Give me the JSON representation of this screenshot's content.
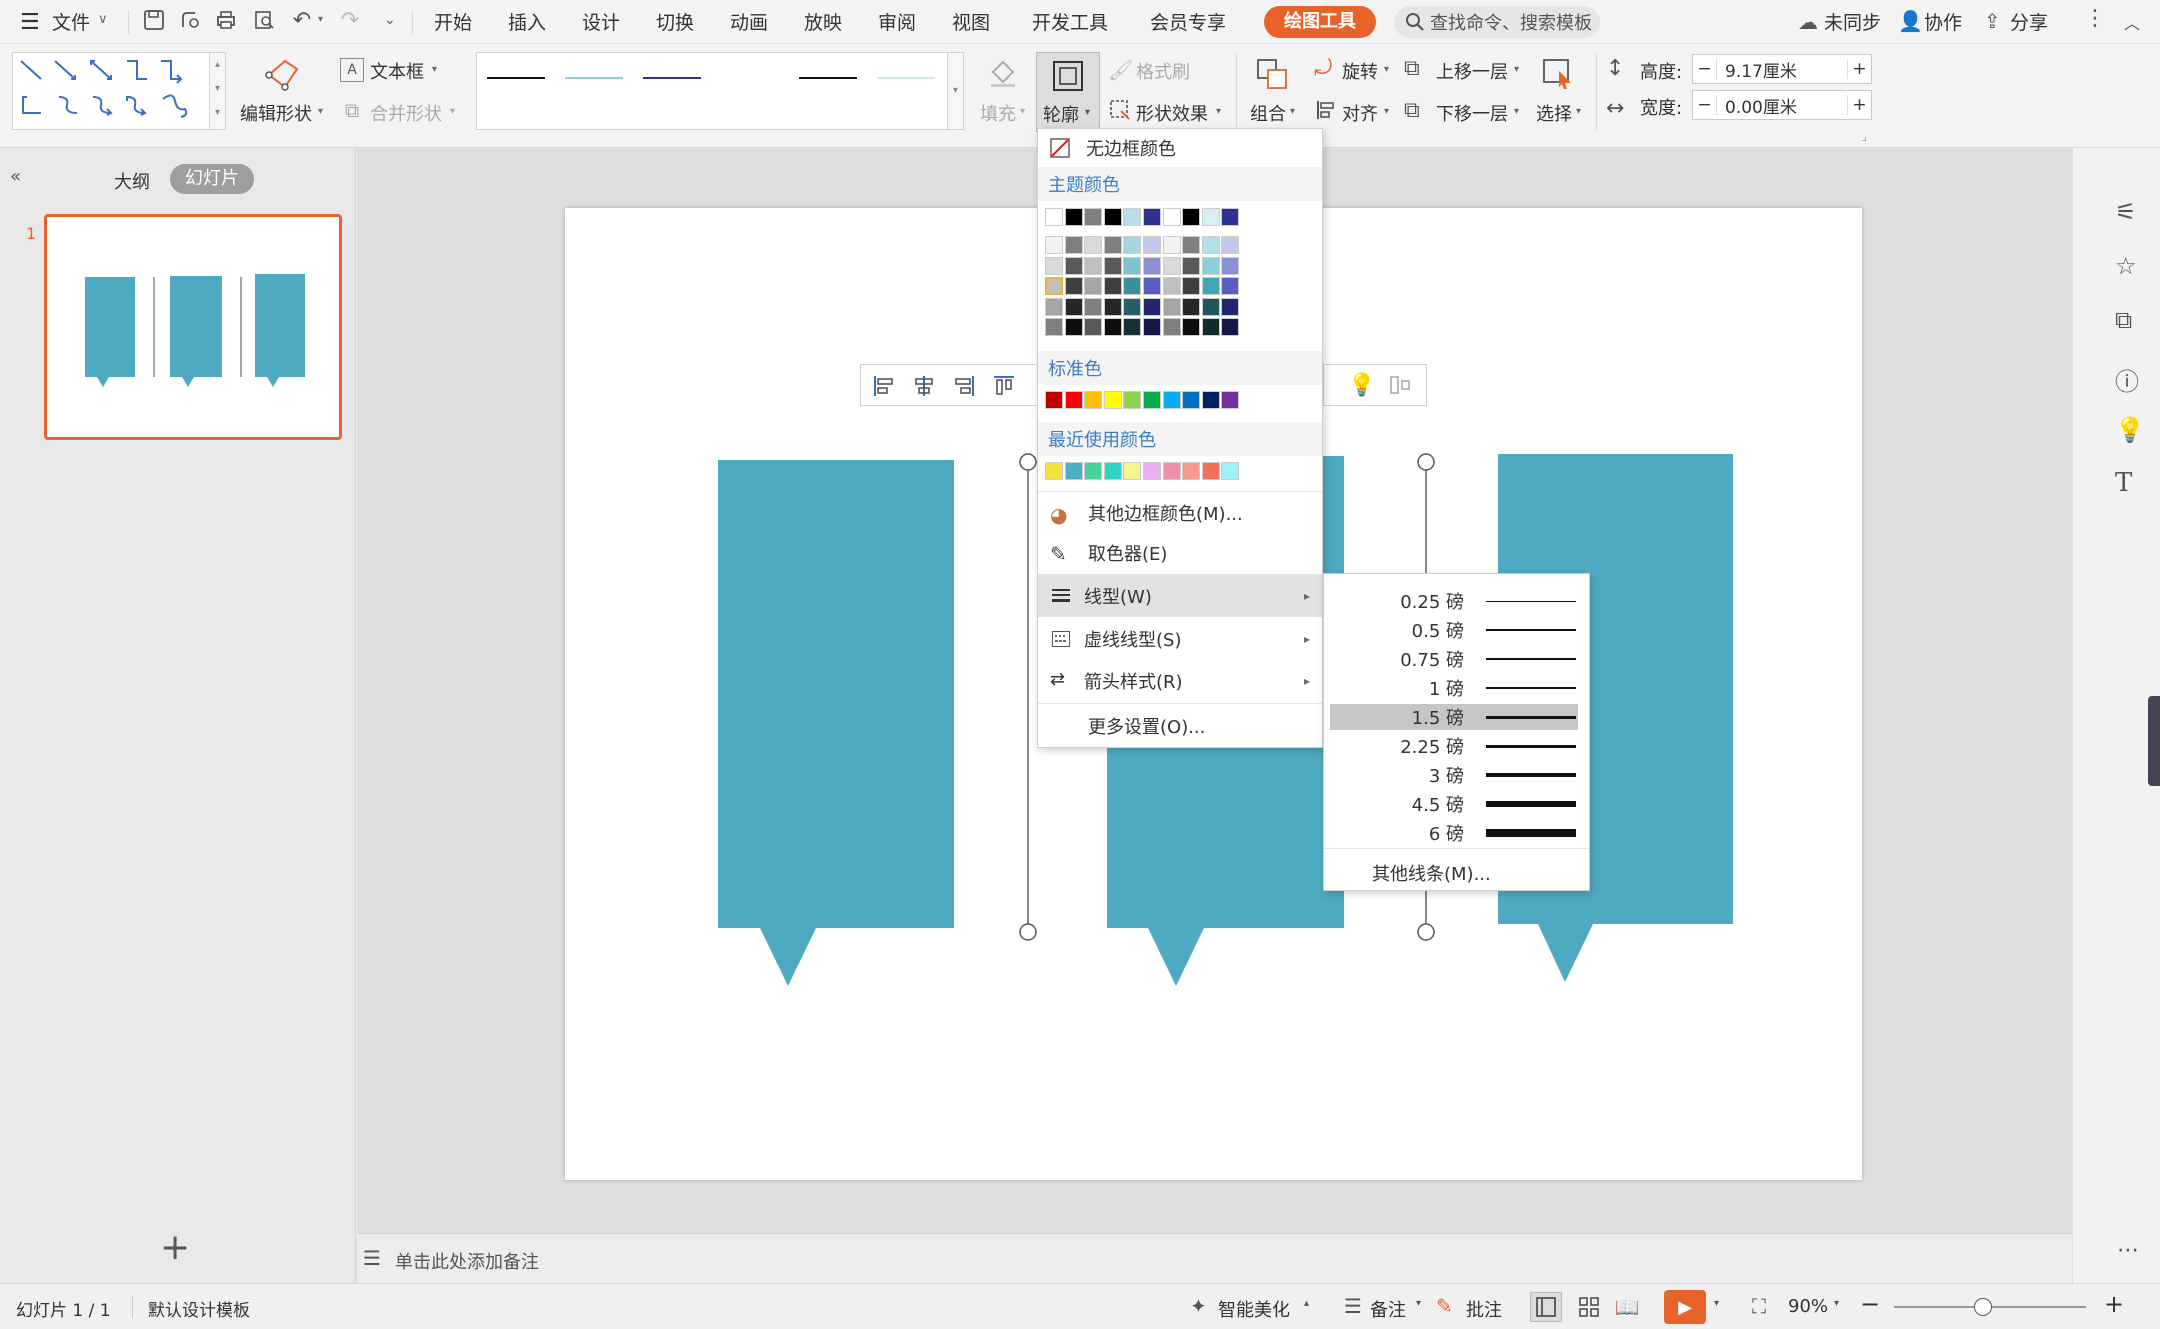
{
  "menubar": {
    "file": "文件",
    "tabs": [
      "开始",
      "插入",
      "设计",
      "切换",
      "动画",
      "放映",
      "审阅",
      "视图",
      "开发工具",
      "会员专享"
    ],
    "active_tab": "绘图工具",
    "search_placeholder": "查找命令、搜索模板",
    "sync": "未同步",
    "collab": "协作",
    "share": "分享"
  },
  "ribbon": {
    "edit_shape": "编辑形状",
    "textbox": "文本框",
    "merge_shape": "合并形状",
    "fill": "填充",
    "outline": "轮廓",
    "format_painter": "格式刷",
    "shape_effect": "形状效果",
    "group": "组合",
    "rotate": "旋转",
    "align": "对齐",
    "bring_forward": "上移一层",
    "send_backward": "下移一层",
    "select": "选择",
    "height_label": "高度:",
    "height_value": "9.17厘米",
    "width_label": "宽度:",
    "width_value": "0.00厘米",
    "minus": "−",
    "plus": "+"
  },
  "leftpanel": {
    "outline_tab": "大纲",
    "slides_tab": "幻灯片",
    "slide_number": "1",
    "add": "+"
  },
  "notes": {
    "placeholder": "单击此处添加备注"
  },
  "outline_menu": {
    "no_border": "无边框颜色",
    "theme_colors": "主题颜色",
    "standard_colors": "标准色",
    "recent_colors": "最近使用颜色",
    "more_border_colors": "其他边框颜色(M)...",
    "eyedropper": "取色器(E)",
    "line_type": "线型(W)",
    "dash_type": "虚线线型(S)",
    "arrow_style": "箭头样式(R)",
    "more_settings": "更多设置(O)...",
    "theme_top_row": [
      "#ffffff",
      "#000000",
      "#7f7f7f",
      "#000000",
      "#b7dde8",
      "#2e3192",
      "#ffffff",
      "#000000",
      "#d9eef2",
      "#2e3192"
    ],
    "theme_grid": [
      [
        "#f2f2f2",
        "#7f7f7f",
        "#d9d9d9",
        "#7f7f7f",
        "#a6d6dd",
        "#c5c7ea",
        "#f2f2f2",
        "#7f7f7f",
        "#b3e0e6",
        "#c5c7ea"
      ],
      [
        "#d9d9d9",
        "#595959",
        "#bfbfbf",
        "#595959",
        "#7ec4cf",
        "#8b8fd6",
        "#d9d9d9",
        "#595959",
        "#8ccfd8",
        "#8b8fd6"
      ],
      [
        "#bfbfbf",
        "#3f3f3f",
        "#a5a5a5",
        "#3f3f3f",
        "#3a8f9c",
        "#5a5fc4",
        "#bfbfbf",
        "#3f3f3f",
        "#3fa7b4",
        "#5a5fc4"
      ],
      [
        "#a5a5a5",
        "#262626",
        "#7f7f7f",
        "#262626",
        "#255f67",
        "#22266e",
        "#a5a5a5",
        "#262626",
        "#1e5660",
        "#22266e"
      ],
      [
        "#7f7f7f",
        "#0d0d0d",
        "#595959",
        "#0d0d0d",
        "#133036",
        "#161948",
        "#7f7f7f",
        "#0d0d0d",
        "#0f2c31",
        "#161948"
      ]
    ],
    "standard": [
      "#c00000",
      "#ff0000",
      "#ffc000",
      "#ffff00",
      "#92d050",
      "#00b050",
      "#00b0f0",
      "#0070c0",
      "#002060",
      "#7030a0"
    ],
    "recent": [
      "#f0e040",
      "#4eaec3",
      "#4bd09a",
      "#2ed6c0",
      "#f5f590",
      "#e8b0f0",
      "#f090a8",
      "#f59a8c",
      "#f07060",
      "#a0f0f8"
    ]
  },
  "linetype_sub": {
    "weights": [
      "0.25 磅",
      "0.5 磅",
      "0.75 磅",
      "1 磅",
      "1.5 磅",
      "2.25 磅",
      "3 磅",
      "4.5 磅",
      "6 磅"
    ],
    "thickness": [
      1,
      1.5,
      1.5,
      2,
      3,
      3,
      4,
      6,
      8
    ],
    "selected_index": 4,
    "other_lines": "其他线条(M)..."
  },
  "slide": {
    "shape_color": "#4eaac1"
  },
  "statusbar": {
    "slide_count": "幻灯片 1 / 1",
    "template": "默认设计模板",
    "beautify": "智能美化",
    "notes": "备注",
    "comments": "批注",
    "zoom": "90%",
    "zoom_minus": "−",
    "zoom_plus": "+"
  },
  "colors": {
    "accent": "#e8622c",
    "active_tab_bg": "#e8622c",
    "menu_blue": "#3b7cc6"
  }
}
